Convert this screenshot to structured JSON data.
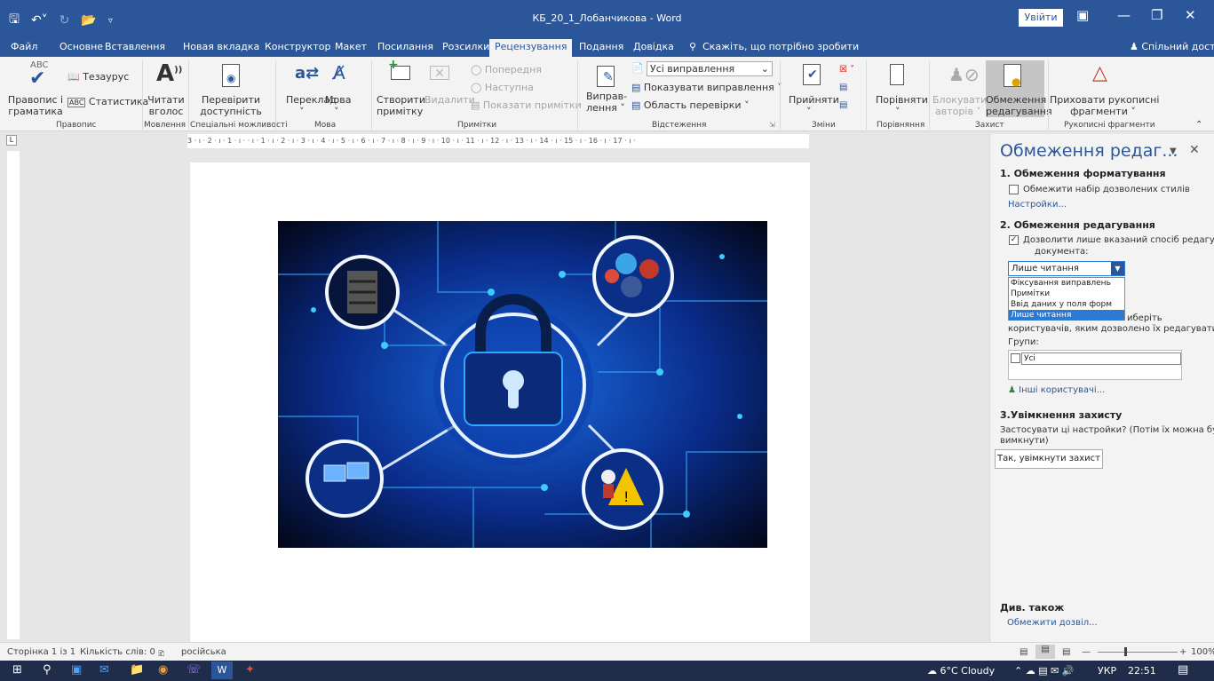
{
  "app": {
    "title": "КБ_20_1_Лобанчикова  -  Word",
    "signin": "Увійти"
  },
  "tabs": {
    "file": "Файл",
    "home": "Основне",
    "insert": "Вставлення",
    "newtab": "Новая вкладка",
    "design": "Конструктор",
    "layout": "Макет",
    "references": "Посилання",
    "mailings": "Розсилки",
    "review": "Рецензування",
    "view": "Подання",
    "help": "Довідка",
    "tell_me": "Скажіть, що потрібно зробити",
    "share": "Спільний доступ"
  },
  "ribbon": {
    "proofing": {
      "spelling_l1": "Правопис і",
      "spelling_l2": "граматика",
      "thesaurus": "Тезаурус",
      "stats": "Статистика",
      "group": "Правопис"
    },
    "speech": {
      "read_l1": "Читати",
      "read_l2": "вголос",
      "group": "Мовлення"
    },
    "accessibility": {
      "check_l1": "Перевірити",
      "check_l2": "доступність",
      "group": "Спеціальні можливості"
    },
    "language": {
      "translate": "Переклад",
      "language": "Мова",
      "group": "Мова"
    },
    "comments": {
      "new_l1": "Створити",
      "new_l2": "примітку",
      "delete": "Видалити",
      "previous": "Попередня",
      "next": "Наступна",
      "show": "Показати примітки",
      "group": "Примітки"
    },
    "tracking": {
      "track_l1": "Виправ-",
      "track_l2": "лення",
      "markup_select": "Усі виправлення",
      "show_markup": "Показувати виправлення",
      "review_pane": "Область перевірки",
      "group": "Відстеження"
    },
    "changes": {
      "accept": "Прийняти",
      "group": "Зміни"
    },
    "compare": {
      "compare": "Порівняти",
      "group": "Порівняння"
    },
    "protect": {
      "block_l1": "Блокувати",
      "block_l2": "авторів",
      "restrict_l1": "Обмеження",
      "restrict_l2": "редагування",
      "group": "Захист"
    },
    "ink": {
      "hide_l1": "Приховати рукописні",
      "hide_l2": "фрагменти",
      "group": "Рукописні фрагменти"
    }
  },
  "ruler": {
    "marks": "3 · ı · 2 · ı · 1 · ı ·  · ı · 1 · ı · 2 · ı · 3 · ı · 4 · ı · 5 · ı · 6 · ı · 7 · ı · 8 · ı · 9 · ı · 10 · ı · 11 · ı · 12 · ı · 13 · ı · 14 · ı · 15 · ı · 16 · ı · 17 · ı ·"
  },
  "pane": {
    "title": "Обмеження редаг...",
    "s1_title": "1. Обмеження форматування",
    "s1_check": "Обмежити набір дозволених стилів",
    "s1_settings": "Настройки...",
    "s2_title": "2. Обмеження редагування",
    "s2_check_l1": "Дозволити лише вказаний спосіб редагування",
    "s2_check_l2": "документа:",
    "s2_select": "Лише читання",
    "s2_options": [
      "Фіксування виправлень",
      "Примітки",
      "Ввід даних у поля форм",
      "Лише читання"
    ],
    "exceptions_l1": "иберіть",
    "exceptions_l2": "користувачів, яким дозволено їх редагувати.",
    "groups_label": "Групи:",
    "groups_all": "Усі",
    "more_users": "Інші користувачі...",
    "s3_title": "3.Увімкнення захисту",
    "s3_text_l1": "Застосувати ці настройки? (Потім їх можна буде",
    "s3_text_l2": "вимкнути)",
    "s3_button": "Так, увімкнути захист",
    "see_also": "Див. також",
    "restrict_perm": "Обмежити дозвіл..."
  },
  "status": {
    "page": "Сторінка 1 із 1",
    "words": "Кількість слів: 0",
    "lang": "російська",
    "zoom": "100%"
  },
  "taskbar": {
    "weather": "6°C  Cloudy",
    "lang": "УКР",
    "time": "22:51"
  }
}
